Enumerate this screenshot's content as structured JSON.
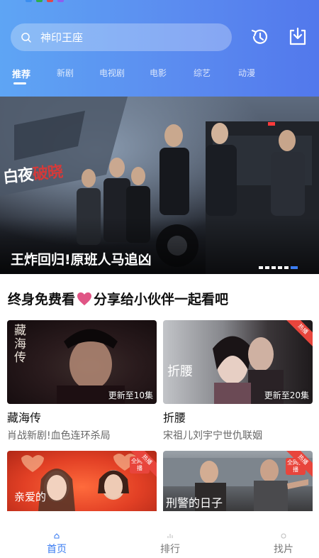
{
  "search": {
    "placeholder": "神印王座"
  },
  "tabs": [
    {
      "label": "推荐",
      "active": true
    },
    {
      "label": "新剧"
    },
    {
      "label": "电视剧"
    },
    {
      "label": "电影"
    },
    {
      "label": "综艺"
    },
    {
      "label": "动漫"
    }
  ],
  "banner": {
    "calligraphy_a": "白夜",
    "calligraphy_b": "破晓",
    "title": "王炸回归!原班人马追凶",
    "slide_count": 6,
    "active_slide": 6
  },
  "section": {
    "title_left": "终身免费看",
    "title_right": "分享给小伙伴一起看吧"
  },
  "cards": [
    {
      "title": "藏海传",
      "subtitle": "肖战新剧!血色连环杀局",
      "note": "更新至10集",
      "poster_text": "藏海传",
      "hot": false
    },
    {
      "title": "折腰",
      "subtitle": "宋祖儿刘宇宁世仇联姻",
      "note": "更新至20集",
      "poster_text": "折腰",
      "hot": true,
      "hot_label": "热播"
    },
    {
      "title": "",
      "subtitle": "",
      "note": "",
      "poster_text": "亲爱的",
      "hot": true,
      "hot_label": "热播",
      "badge": "全网独播"
    },
    {
      "title": "",
      "subtitle": "",
      "note": "",
      "poster_text": "刑警的日子",
      "hot": true,
      "hot_label": "热播",
      "badge": "全网独播"
    }
  ],
  "bottom_nav": [
    {
      "label": "首页",
      "active": true
    },
    {
      "label": "排行"
    },
    {
      "label": "找片"
    }
  ],
  "colors": {
    "accent": "#3a7cf2",
    "header_from": "#5ea5f4",
    "header_to": "#5278ec",
    "heart": "#e05585",
    "hot": "#e8453c"
  }
}
